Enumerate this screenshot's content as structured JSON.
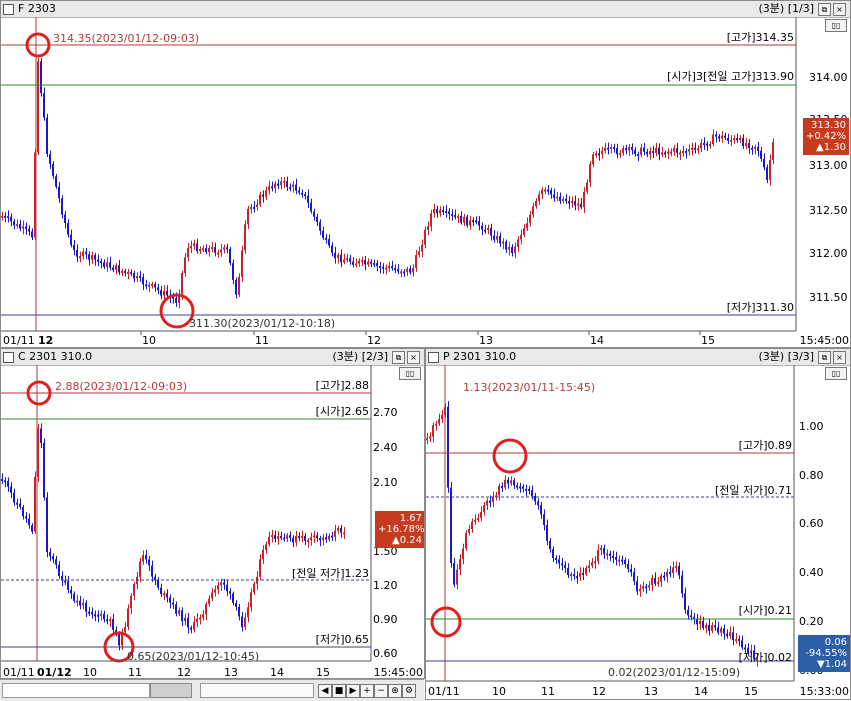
{
  "tooltip": "대비",
  "pane1": {
    "title": "F 2303",
    "page": "(3분) [1/3]",
    "time": "15:45:00",
    "high_tag": "[고가]314.35",
    "open_tag": "[시가]3[전일 고가]313.90",
    "low_tag": "[저가]311.30",
    "high_ann": "314.35(2023/01/12-09:03)",
    "low_ann": "311.30(2023/01/12-10:18)",
    "badge": [
      "313.30",
      "+0.42%",
      "▲1.30"
    ],
    "x_labels": [
      "01/11",
      "12",
      "10",
      "11",
      "12",
      "13",
      "14",
      "15"
    ],
    "y_labels": [
      "314.00",
      "313.50",
      "313.00",
      "312.50",
      "312.00",
      "311.50"
    ],
    "colors": {
      "up": "#c8232c",
      "down": "#1a1ac8",
      "high_line": "#b33a3a",
      "open_line": "#2a8a2a",
      "low_line": "#3b3b8f",
      "marker": "#e02020",
      "badge": "#c83a1d"
    }
  },
  "pane2": {
    "title": "C 2301 310.0",
    "page": "(3분) [2/3]",
    "time": "15:45:00",
    "high_tag": "[고가]2.88",
    "open_tag": "[시가]2.65",
    "prev_low_tag": "[전일 저가]1.23",
    "low_tag": "[저가]0.65",
    "high_ann": "2.88(2023/01/12-09:03)",
    "low_ann": "0.65(2023/01/12-10:45)",
    "badge": [
      "1.67",
      "+16.78%",
      "▲0.24"
    ],
    "x_labels": [
      "01/11",
      "01/12",
      "10",
      "11",
      "12",
      "13",
      "14",
      "15"
    ],
    "y_labels": [
      "2.70",
      "2.40",
      "2.10",
      "1.50",
      "1.20",
      "0.90",
      "0.60"
    ]
  },
  "pane3": {
    "title": "P 2301 310.0",
    "page": "(3분) [3/3]",
    "time": "15:33:00",
    "high_tag": "[고가]0.89",
    "prev_low_tag": "[전일 저가]0.71",
    "open_tag": "[시가]0.21",
    "low_tag": "[저가]0.02",
    "high_ann": "1.13(2023/01/11-15:45)",
    "low_ann": "0.02(2023/01/12-15:09)",
    "badge": [
      "0.06",
      "-94.55%",
      "▼1.04"
    ],
    "x_labels": [
      "01/11",
      "10",
      "11",
      "12",
      "13",
      "14",
      "15"
    ],
    "y_labels": [
      "1.00",
      "0.80",
      "0.60",
      "0.40",
      "0.20",
      "0.00"
    ]
  }
}
